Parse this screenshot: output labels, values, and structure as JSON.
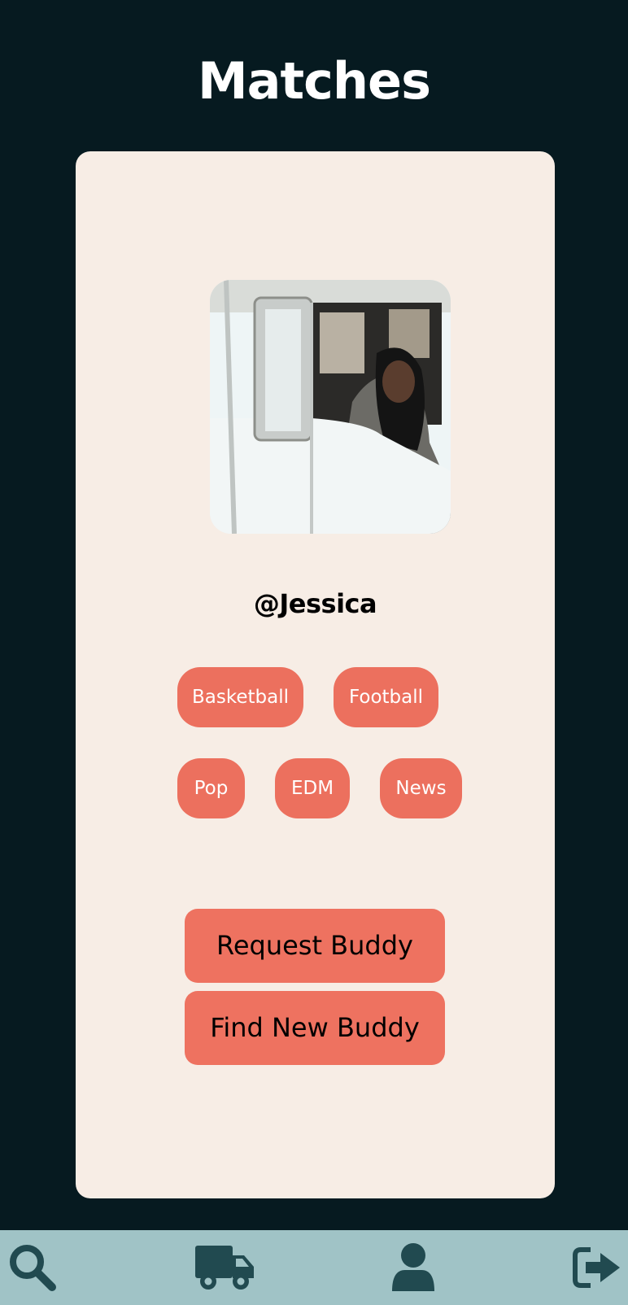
{
  "header": {
    "title": "Matches"
  },
  "profile": {
    "username": "@Jessica",
    "photo_icon": "profile-photo",
    "tags_row1": [
      "Basketball",
      "Football"
    ],
    "tags_row2": [
      "Pop",
      "EDM",
      "News"
    ]
  },
  "actions": {
    "request_label": "Request Buddy",
    "find_label": "Find New Buddy"
  },
  "nav": {
    "items": [
      {
        "icon": "search-icon"
      },
      {
        "icon": "truck-icon"
      },
      {
        "icon": "user-icon"
      },
      {
        "icon": "sign-out-icon"
      }
    ]
  },
  "colors": {
    "background": "#061a20",
    "card": "#f7ede5",
    "accent": "#ec705e",
    "nav_bar": "#a0c3c6",
    "nav_icon": "#214a50"
  }
}
